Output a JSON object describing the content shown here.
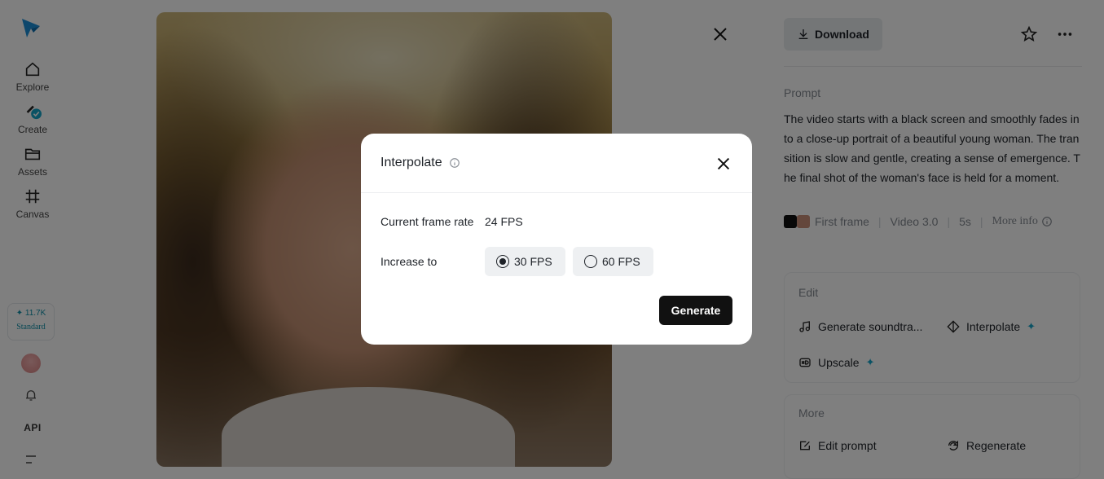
{
  "sidebar": {
    "nav": [
      {
        "label": "Explore",
        "icon": "home-icon"
      },
      {
        "label": "Create",
        "icon": "create-icon"
      },
      {
        "label": "Assets",
        "icon": "folder-icon"
      },
      {
        "label": "Canvas",
        "icon": "canvas-icon"
      }
    ],
    "credits": {
      "amount": "✦ 11.7K",
      "tier": "Standard"
    },
    "api_label": "API"
  },
  "viewer": {
    "close_icon": "close-icon"
  },
  "panel": {
    "download_label": "Download",
    "prompt_heading": "Prompt",
    "prompt_text": "The video starts with a black screen and smoothly fades in to a close-up portrait of a beautiful young woman. The transition is slow and gentle, creating a sense of emergence. The final shot of the woman's face is held for a moment.",
    "meta": {
      "first_frame": "First frame",
      "model": "Video 3.0",
      "duration": "5s",
      "more_info": "More info"
    },
    "edit": {
      "heading": "Edit",
      "generate_soundtrack": "Generate soundtra...",
      "interpolate": "Interpolate",
      "upscale": "Upscale"
    },
    "more": {
      "heading": "More",
      "edit_prompt": "Edit prompt",
      "regenerate": "Regenerate"
    }
  },
  "modal": {
    "title": "Interpolate",
    "current_label": "Current frame rate",
    "current_value": "24 FPS",
    "increase_label": "Increase to",
    "options": [
      {
        "label": "30 FPS",
        "selected": true
      },
      {
        "label": "60 FPS",
        "selected": false
      }
    ],
    "generate_label": "Generate"
  },
  "colors": {
    "accent": "#14a5c9",
    "primary_button": "#111111",
    "overlay": "rgba(0,0,0,0.5)"
  }
}
